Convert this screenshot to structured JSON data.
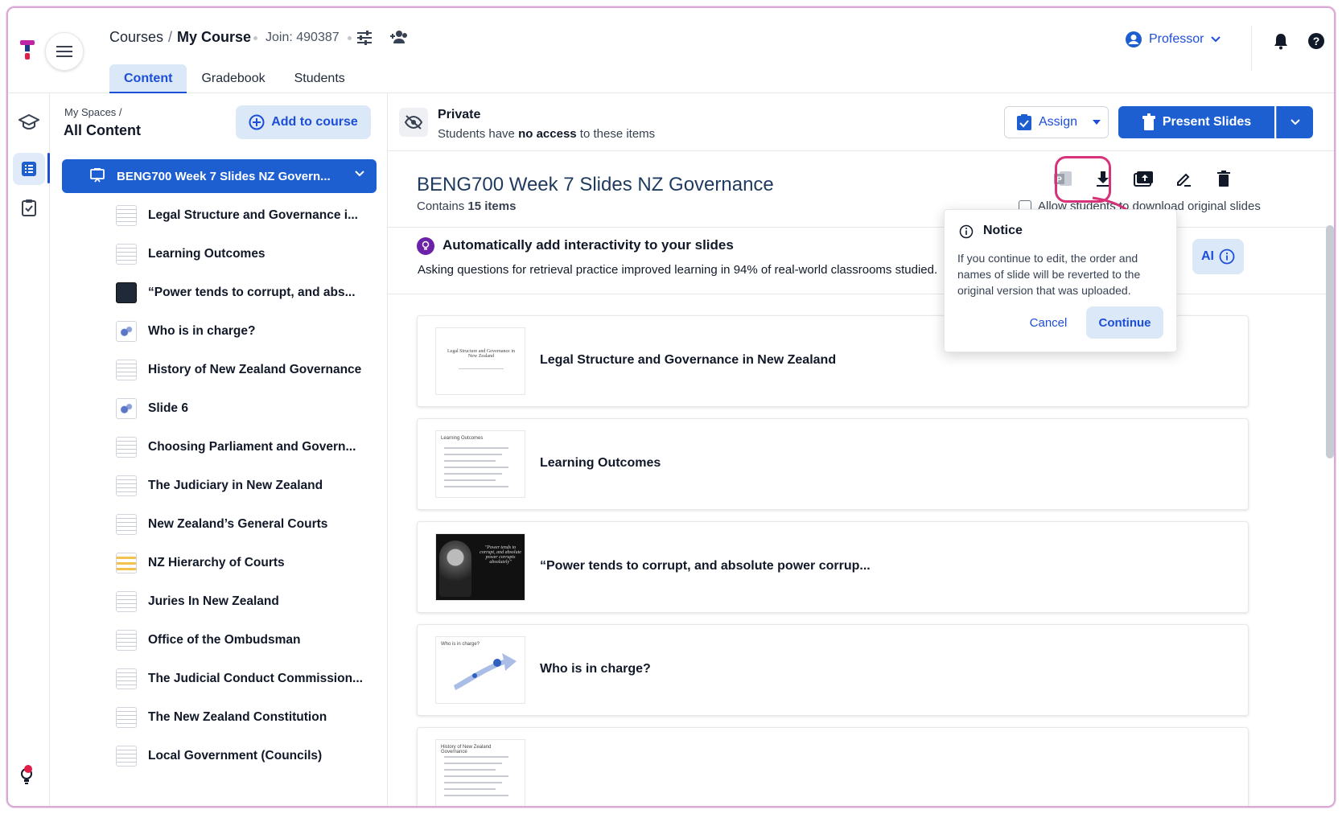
{
  "header": {
    "breadcrumb_root": "Courses",
    "breadcrumb_sep": "/",
    "breadcrumb_current": "My Course",
    "join_label": "Join: 490387",
    "user_label": "Professor",
    "tabs": [
      {
        "label": "Content"
      },
      {
        "label": "Gradebook"
      },
      {
        "label": "Students"
      }
    ]
  },
  "sidebar": {
    "path": "My Spaces /",
    "title": "All Content",
    "add_label": "Add to course",
    "deck_label": "BENG700 Week 7 Slides NZ Govern...",
    "slides": [
      {
        "label": "Legal Structure and Governance i...",
        "thumb": "lines"
      },
      {
        "label": "Learning Outcomes",
        "thumb": "lines"
      },
      {
        "label": "“Power tends to corrupt, and abs...",
        "thumb": "dark"
      },
      {
        "label": "Who is in charge?",
        "thumb": "blue"
      },
      {
        "label": "History of New Zealand Governance",
        "thumb": "lines"
      },
      {
        "label": "Slide 6",
        "thumb": "blue"
      },
      {
        "label": "Choosing Parliament and Govern...",
        "thumb": "lines"
      },
      {
        "label": "The Judiciary in New Zealand",
        "thumb": "lines"
      },
      {
        "label": "New Zealand’s General Courts",
        "thumb": "lines"
      },
      {
        "label": "NZ Hierarchy of Courts",
        "thumb": "yellow"
      },
      {
        "label": "Juries In New Zealand",
        "thumb": "lines"
      },
      {
        "label": "Office of the Ombudsman",
        "thumb": "lines"
      },
      {
        "label": "The Judicial Conduct Commission...",
        "thumb": "lines"
      },
      {
        "label": "The New Zealand Constitution",
        "thumb": "lines"
      },
      {
        "label": "Local Government (Councils)",
        "thumb": "lines"
      }
    ]
  },
  "privacy": {
    "title": "Private",
    "sub_prefix": "Students have ",
    "sub_bold": "no access",
    "sub_suffix": " to these items",
    "assign_label": "Assign",
    "present_label": "Present Slides"
  },
  "deck": {
    "title": "BENG700 Week 7 Slides NZ Governance",
    "contains_prefix": "Contains ",
    "contains_count": "15 items",
    "allow_label": "Allow students to download original slides"
  },
  "interactivity": {
    "title": "Automatically add interactivity to your slides",
    "subtitle": "Asking questions for retrieval practice improved learning in 94% of real-world classrooms studied.",
    "ai_label": "AI"
  },
  "cards": [
    {
      "title": "Legal Structure and Governance in New Zealand",
      "thumb_text": "Legal Structure and Governance in New Zealand",
      "thumb": "title"
    },
    {
      "title": "Learning Outcomes",
      "thumb_text": "Learning Outcomes",
      "thumb": "bullets"
    },
    {
      "title": "“Power tends to corrupt, and absolute power corrup...",
      "thumb_text": "\"Power tends to corrupt, and absolute power corrupts absolutely\"",
      "thumb": "dark"
    },
    {
      "title": "Who is in charge?",
      "thumb_text": "Who is in charge?",
      "thumb": "arrow"
    },
    {
      "title": "",
      "thumb_text": "History of New Zealand Governance",
      "thumb": "bullets"
    }
  ],
  "notice": {
    "title": "Notice",
    "body": "If you continue to edit, the order and names of slide will be reverted to the original version that was uploaded.",
    "cancel": "Cancel",
    "continue": "Continue"
  },
  "colors": {
    "brand_blue": "#1d5fd0",
    "accent_pink": "#d6337a",
    "light_blue": "#dbe8f7"
  }
}
